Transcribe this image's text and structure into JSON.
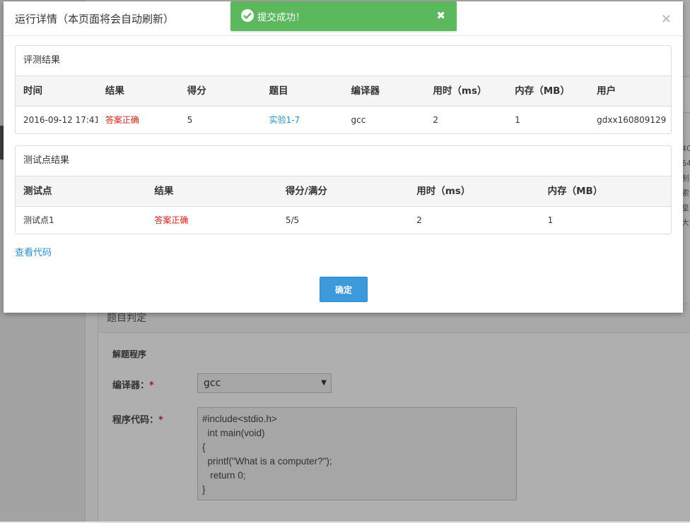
{
  "modal": {
    "title": "运行详情（本页面将会自动刷新）",
    "close_glyph": "×",
    "view_code_link": "查看代码",
    "ok_button": "确定"
  },
  "toast": {
    "message": "提交成功！",
    "close_glyph": "✖",
    "color": "#5cb85c"
  },
  "eval": {
    "title": "评测结果",
    "headers": [
      "时间",
      "结果",
      "得分",
      "题目",
      "编译器",
      "用时（ms）",
      "内存（MB）",
      "用户"
    ],
    "row": [
      "2016-09-12 17:41",
      "答案正确",
      "5",
      "实验1-7",
      "gcc",
      "2",
      "1",
      "gdxx160809129"
    ]
  },
  "testpoints": {
    "title": "测试点结果",
    "headers": [
      "测试点",
      "结果",
      "得分/满分",
      "用时（ms）",
      "内存（MB）"
    ],
    "row": [
      "测试点1",
      "答案正确",
      "5/5",
      "2",
      "1"
    ]
  },
  "background": {
    "panel_title": "题目判定",
    "section_title": "解题程序",
    "compiler_label": "编译器：",
    "code_label": "程序代码：",
    "required_mark": "*",
    "compiler_value": "gcc",
    "code": "#include<stdio.h>\n  int main(void)\n{\n  printf(\"What is a computer?\");\n   return 0;\n}",
    "right_edge_fragments": [
      "40",
      "64",
      "制",
      "索",
      "皇",
      "大"
    ]
  },
  "colors": {
    "accent": "#3b99dc",
    "link": "#2a8fc8",
    "correct": "#d9251d"
  }
}
